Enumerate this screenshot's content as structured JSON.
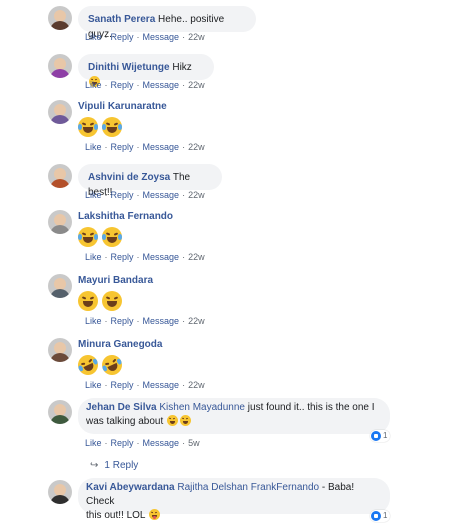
{
  "comments": [
    {
      "name": "Sanath Perera",
      "text": "Hehe.. positive guyz..",
      "emojis": [],
      "actions": [
        "Like",
        "Reply",
        "Message"
      ],
      "time": "22w"
    },
    {
      "name": "Dinithi Wijetunge",
      "text": "Hikz",
      "emojis": [
        "tears-of-joy"
      ],
      "actions": [
        "Like",
        "Reply",
        "Message"
      ],
      "time": "22w"
    },
    {
      "name": "Vipuli Karunaratne",
      "text": "",
      "emojis": [
        "tears-of-joy",
        "tears-of-joy"
      ],
      "actions": [
        "Like",
        "Reply",
        "Message"
      ],
      "time": "22w"
    },
    {
      "name": "Ashvini de Zoysa",
      "text": "The best!!",
      "emojis": [],
      "actions": [
        "Like",
        "Reply",
        "Message"
      ],
      "time": "22w"
    },
    {
      "name": "Lakshitha Fernando",
      "text": "",
      "emojis": [
        "tears-of-joy",
        "tears-of-joy"
      ],
      "actions": [
        "Like",
        "Reply",
        "Message"
      ],
      "time": "22w"
    },
    {
      "name": "Mayuri Bandara",
      "text": "",
      "emojis": [
        "laughing",
        "laughing"
      ],
      "actions": [
        "Like",
        "Reply",
        "Message"
      ],
      "time": "22w"
    },
    {
      "name": "Minura Ganegoda",
      "text": "",
      "emojis": [
        "rolling-laughing",
        "rolling-laughing"
      ],
      "actions": [
        "Like",
        "Reply",
        "Message"
      ],
      "time": "22w"
    },
    {
      "name": "Jehan De Silva",
      "mention": "Kishen Mayadunne",
      "text_line1": "just found it.. this is the one I",
      "text_line2": "was talking about",
      "actions": [
        "Like",
        "Reply",
        "Message"
      ],
      "time": "5w",
      "reaction_count": "1",
      "replies_label": "1 Reply"
    },
    {
      "name": "Kavi Abeywardana",
      "mention": "Rajitha Delshan FrankFernando",
      "text_line1": "- Baba! Check",
      "text_line2": "this out!! LOL",
      "reaction_count": "1"
    }
  ],
  "colors": {
    "link": "#385898",
    "bubble": "#f2f3f5",
    "meta": "#606770",
    "like": "#1877f2"
  }
}
